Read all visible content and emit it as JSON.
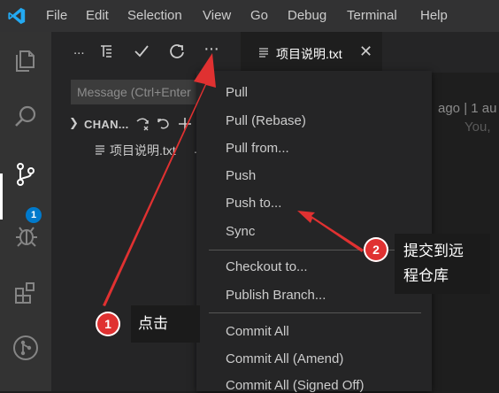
{
  "menubar": {
    "items": [
      "File",
      "Edit",
      "Selection",
      "View",
      "Go",
      "Debug",
      "Terminal",
      "Help"
    ]
  },
  "activity": {
    "scm_badge": "1",
    "icons": [
      "files-icon",
      "search-icon",
      "source-control-icon",
      "debug-icon",
      "extensions-icon",
      "git-graph-icon"
    ]
  },
  "scm": {
    "toolbar_ellipsis": "...",
    "more_actions": "···",
    "message_placeholder": "Message (Ctrl+Enter",
    "changes_label": "CHAN...",
    "file_name": "项目说明.txt",
    "file_trailing": "."
  },
  "editor": {
    "tab_label": "项目说明.txt",
    "tab_close": "✕",
    "blame_line": "ago | 1 au",
    "blame_author": "You,"
  },
  "dropdown": {
    "items": [
      "Pull",
      "Pull (Rebase)",
      "Pull from...",
      "Push",
      "Push to...",
      "Sync",
      "Checkout to...",
      "Publish Branch...",
      "Commit All",
      "Commit All (Amend)",
      "Commit All (Signed Off)"
    ]
  },
  "annotations": {
    "step1_number": "1",
    "step1_text": "点击",
    "step2_number": "2",
    "step2_line1": "提交到远",
    "step2_line2": "程仓库",
    "color": "#e03131"
  }
}
